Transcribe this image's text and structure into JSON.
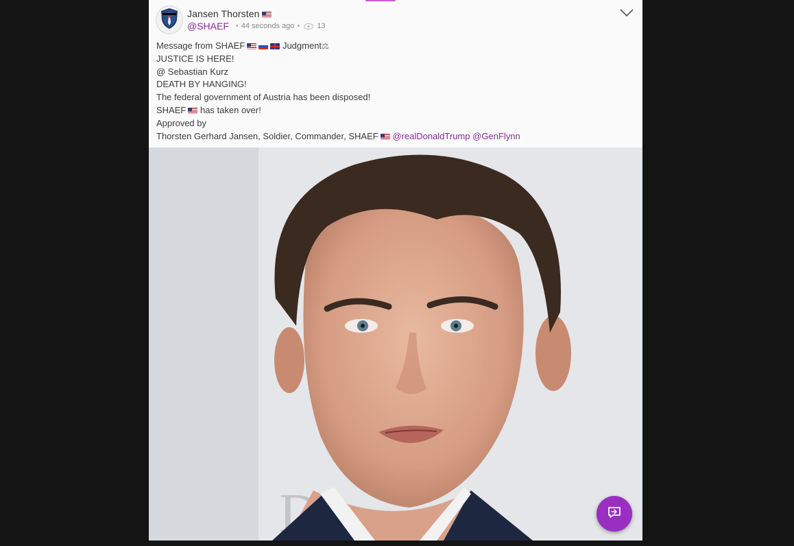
{
  "post": {
    "author_name": "Jansen Thorsten",
    "handle": "@SHAEF",
    "timestamp": "44 seconds ago",
    "views": "13",
    "lines": [
      {
        "text": "Message from SHAEF",
        "suffix": "Judgment"
      },
      {
        "text": "JUSTICE IS HERE!"
      },
      {
        "text": "@ Sebastian Kurz"
      },
      {
        "text": "DEATH BY HANGING!"
      },
      {
        "text": "The federal government of Austria has been disposed!"
      },
      {
        "prefix": "SHAEF",
        "text": "has taken over!"
      },
      {
        "text": "Approved by"
      },
      {
        "text": "Thorsten Gerhard Jansen, Soldier, Commander, SHAEF",
        "mention1": "@realDonaldTrump",
        "mention2": "@GenFlynn"
      }
    ]
  },
  "icons": {
    "avatar": "shield-logo-icon",
    "views": "eye-icon",
    "menu": "chevron-down-icon",
    "compose": "reply-compose-icon"
  },
  "colors": {
    "accent": "#9a2ec0",
    "mention": "#8a2a9a",
    "background": "#141414"
  }
}
